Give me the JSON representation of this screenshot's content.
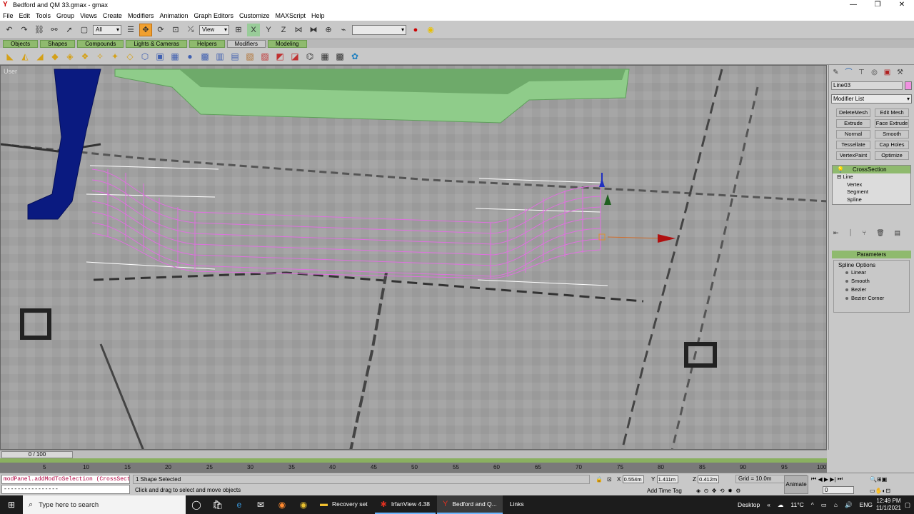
{
  "window": {
    "title": "Bedford and QM 33.gmax - gmax"
  },
  "menu": [
    "File",
    "Edit",
    "Tools",
    "Group",
    "Views",
    "Create",
    "Modifiers",
    "Animation",
    "Graph Editors",
    "Customize",
    "MAXScript",
    "Help"
  ],
  "toolbar": {
    "filter": "All",
    "refcoord": "View",
    "namedsel": ""
  },
  "tabs": [
    "Objects",
    "Shapes",
    "Compounds",
    "Lights & Cameras",
    "Helpers",
    "Modifiers",
    "Modeling"
  ],
  "active_tab": "Modifiers",
  "viewport": {
    "label": "User"
  },
  "command_panel": {
    "object_name": "Line03",
    "modifier_list": "Modifier List",
    "modifier_buttons": [
      "DeleteMesh",
      "Edit Mesh",
      "Extrude",
      "Face Extrude",
      "Normal",
      "Smooth",
      "Tessellate",
      "Cap Holes",
      "VertexPaint",
      "Optimize"
    ],
    "stack": {
      "top": "CrossSection",
      "base": "Line",
      "subobjects": [
        "Vertex",
        "Segment",
        "Spline"
      ]
    },
    "parameters": {
      "header": "Parameters",
      "group": "Spline Options",
      "options": [
        "Linear",
        "Smooth",
        "Bezier",
        "Bezier Corner"
      ]
    }
  },
  "timeline": {
    "frame_label": "0 / 100",
    "ticks": [
      "5",
      "10",
      "15",
      "20",
      "25",
      "30",
      "35",
      "40",
      "45",
      "50",
      "55",
      "60",
      "65",
      "70",
      "75",
      "80",
      "85",
      "90",
      "95",
      "100"
    ]
  },
  "status": {
    "maxscript_line": "modPanel.addModToSelection (CrossSecti",
    "maxscript_input": "----------------",
    "selection": "1 Shape Selected",
    "prompt": "Click and drag to select and move objects",
    "x": "0.554m",
    "y": "1.411m",
    "z": "0.412m",
    "x_label": "X",
    "y_label": "Y",
    "z_label": "Z",
    "grid": "Grid = 10.0m",
    "add_time_tag": "Add Time Tag",
    "animate": "Animate",
    "frame": "0"
  },
  "taskbar": {
    "search_placeholder": "Type here to search",
    "apps": [
      "Recovery set",
      "IrfanView 4.38",
      "Bedford and Q...",
      "Links"
    ],
    "desktop": "Desktop",
    "temp": "11°C",
    "lang": "ENG",
    "time": "12:49 PM",
    "date": "11/1/2021"
  }
}
